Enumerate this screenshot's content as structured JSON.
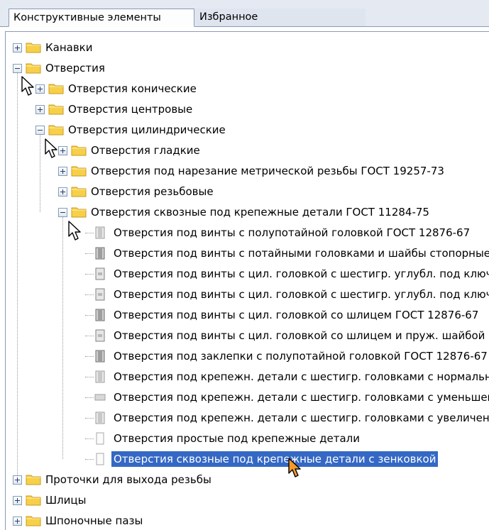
{
  "tabs": [
    {
      "label": "Конструктивные элементы",
      "active": true
    },
    {
      "label": "Избранное",
      "active": false
    }
  ],
  "tree": {
    "items": [
      {
        "label": "Канавки"
      },
      {
        "label": "Отверстия"
      },
      {
        "label": "Отверстия конические"
      },
      {
        "label": "Отверстия центровые"
      },
      {
        "label": "Отверстия цилиндрические"
      },
      {
        "label": "Отверстия гладкие"
      },
      {
        "label": "Отверстия под нарезание метрической резьбы ГОСТ 19257-73"
      },
      {
        "label": "Отверстия резьбовые"
      },
      {
        "label": "Отверстия сквозные под крепежные детали ГОСТ 11284-75"
      },
      {
        "label": "Отверстия под винты с полупотайной головкой ГОСТ 12876-67"
      },
      {
        "label": "Отверстия под винты с потайными головками и шайбы стопорные"
      },
      {
        "label": "Отверстия под винты с цил. головкой с шестигр. углубл. под ключ"
      },
      {
        "label": "Отверстия под винты с цил. головкой с шестигр. углубл. под ключ"
      },
      {
        "label": "Отверстия под винты с цил. головкой со шлицем ГОСТ 12876-67"
      },
      {
        "label": "Отверстия под винты с цил. головкой со шлицем и пруж. шайбой"
      },
      {
        "label": "Отверстия под заклепки с полупотайной головкой ГОСТ 12876-67"
      },
      {
        "label": "Отверстия под крепежн. детали с шестигр. головками с нормальными"
      },
      {
        "label": "Отверстия под крепежн. детали с шестигр. головками с уменьшенными"
      },
      {
        "label": "Отверстия под крепежн. детали с шестигр. головками с увеличенными"
      },
      {
        "label": "Отверстия простые под крепежные  детали"
      },
      {
        "label": "Отверстия сквозные под крепежные  детали с зенковкой",
        "selected": true
      },
      {
        "label": "Проточки для выхода резьбы"
      },
      {
        "label": "Шлицы"
      },
      {
        "label": "Шпоночные пазы"
      }
    ]
  },
  "colors": {
    "selection": "#3468c4",
    "folder": "#f4c542",
    "tab_strip": "#e4e9f2",
    "cursor_orange": "#f39a2a"
  }
}
